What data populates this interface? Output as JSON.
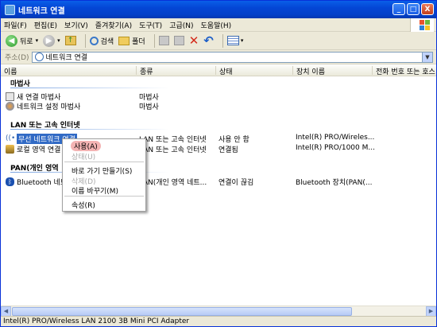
{
  "window": {
    "title": "네트워크 연결",
    "min": "_",
    "max": "□",
    "close": "X"
  },
  "menu": [
    "파일(F)",
    "편집(E)",
    "보기(V)",
    "즐겨찾기(A)",
    "도구(T)",
    "고급(N)",
    "도움말(H)"
  ],
  "toolbar": {
    "back": "뒤로",
    "search": "검색",
    "folders": "폴더"
  },
  "address": {
    "label": "주소(D)",
    "value": "네트워크 연결"
  },
  "columns": [
    "이름",
    "종류",
    "상태",
    "장치 이름",
    "전화 번호 또는 호스"
  ],
  "groups": {
    "wizard": "마법사",
    "lan": "LAN 또는 고속 인터넷",
    "pan": "PAN(개인 영역"
  },
  "rows": [
    {
      "name": "새 연결 마법사",
      "type": "마법사",
      "status": "",
      "device": ""
    },
    {
      "name": "네트워크 설정 마법사",
      "type": "마법사",
      "status": "",
      "device": ""
    },
    {
      "name": "무선 네트워크 연결",
      "type": "LAN 또는 고속 인터넷",
      "status": "사용 안 함",
      "device": "Intel(R) PRO/Wireles..."
    },
    {
      "name": "로컬 영역 연결",
      "type": "LAN 또는 고속 인터넷",
      "status": "연결됨",
      "device": "Intel(R) PRO/1000 M..."
    },
    {
      "name": "Bluetooth 네트",
      "type": "PAN(개인 영역 네트...",
      "status": "연결이 끊김",
      "device": "Bluetooth 장치(PAN(..."
    }
  ],
  "context_menu": {
    "enable": "사용(A)",
    "status": "상태(U)",
    "shortcut": "바로 가기 만들기(S)",
    "delete": "삭제(D)",
    "rename": "이름 바꾸기(M)",
    "properties": "속성(R)"
  },
  "status_bar": "Intel(R) PRO/Wireless LAN 2100 3B Mini PCI Adapter"
}
